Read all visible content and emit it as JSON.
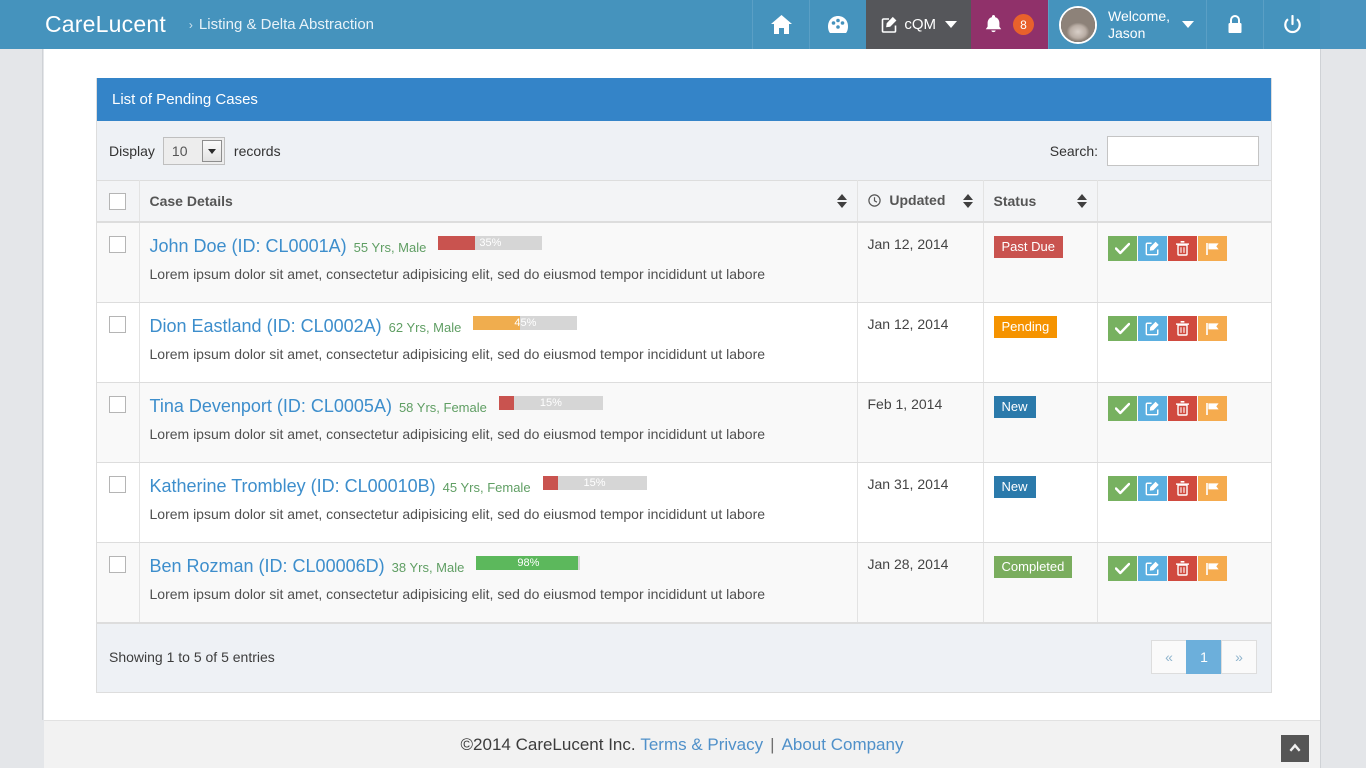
{
  "navbar": {
    "brand": "CareLucent",
    "breadcrumb_chevron": "›",
    "breadcrumb": "Listing & Delta Abstraction",
    "home_icon": "home-icon",
    "dashboard_icon": "dashboard-icon",
    "cqm_label": "cQM",
    "cqm_icon": "compose-icon",
    "bell_icon": "bell-icon",
    "notification_count": "8",
    "welcome_line1": "Welcome,",
    "welcome_line2": "Jason",
    "lock_icon": "lock-icon",
    "power_icon": "power-icon",
    "bg_color": "#4593bd",
    "cqm_bg": "#55565a",
    "bell_bg": "#90316a",
    "badge_bg": "#e8612c"
  },
  "panel": {
    "title": "List of Pending Cases",
    "heading_bg": "#3484c8"
  },
  "controls": {
    "display_label": "Display",
    "records_label": "records",
    "page_length_value": "10",
    "search_label": "Search:",
    "search_value": "",
    "search_placeholder": ""
  },
  "table": {
    "columns": [
      {
        "key": "check",
        "label": ""
      },
      {
        "key": "case",
        "label": "Case Details",
        "sortable": true
      },
      {
        "key": "updated",
        "label": "Updated",
        "sortable": true,
        "icon": "clock-icon"
      },
      {
        "key": "status",
        "label": "Status",
        "sortable": true
      },
      {
        "key": "actions",
        "label": ""
      }
    ],
    "description": "Lorem ipsum dolor sit amet, consectetur adipisicing elit, sed do eiusmod tempor incididunt ut labore",
    "action_labels": {
      "approve": "check-icon",
      "edit": "edit-icon",
      "delete": "trash-icon",
      "flag": "flag-icon"
    },
    "action_colors": {
      "approve": "#77b160",
      "edit": "#5bafe0",
      "delete": "#d04a3f",
      "flag": "#f5ab4e"
    },
    "rows": [
      {
        "name": "John Doe (ID: CL0001A)",
        "meta": "55 Yrs, Male",
        "progress": 35,
        "progress_label": "35%",
        "progress_color": "#c9534f",
        "updated": "Jan 12, 2014",
        "status": "Past Due",
        "status_color": "#c9534f"
      },
      {
        "name": "Dion Eastland (ID: CL0002A)",
        "meta": "62 Yrs, Male",
        "progress": 45,
        "progress_label": "45%",
        "progress_color": "#f0ad4e",
        "updated": "Jan 12, 2014",
        "status": "Pending",
        "status_color": "#f59300"
      },
      {
        "name": "Tina Devenport (ID: CL0005A)",
        "meta": "58 Yrs, Female",
        "progress": 15,
        "progress_label": "15%",
        "progress_color": "#c9534f",
        "updated": "Feb 1, 2014",
        "status": "New",
        "status_color": "#2b7aab"
      },
      {
        "name": "Katherine Trombley (ID: CL00010B)",
        "meta": "45 Yrs, Female",
        "progress": 15,
        "progress_label": "15%",
        "progress_color": "#c9534f",
        "updated": "Jan 31, 2014",
        "status": "New",
        "status_color": "#2b7aab"
      },
      {
        "name": "Ben Rozman (ID: CL00006D)",
        "meta": "38 Yrs, Male",
        "progress": 98,
        "progress_label": "98%",
        "progress_color": "#5cb85c",
        "updated": "Jan 28, 2014",
        "status": "Completed",
        "status_color": "#7aad5e"
      }
    ]
  },
  "pagination": {
    "showing": "Showing 1 to 5 of 5 entries",
    "prev": "«",
    "next": "»",
    "pages": [
      "1"
    ],
    "current": "1"
  },
  "footer": {
    "copyright": "©2014 CareLucent Inc.",
    "terms_link": "Terms & Privacy",
    "separator": "|",
    "about_link": "About Company",
    "scroll_top_icon": "chevron-up-icon"
  }
}
